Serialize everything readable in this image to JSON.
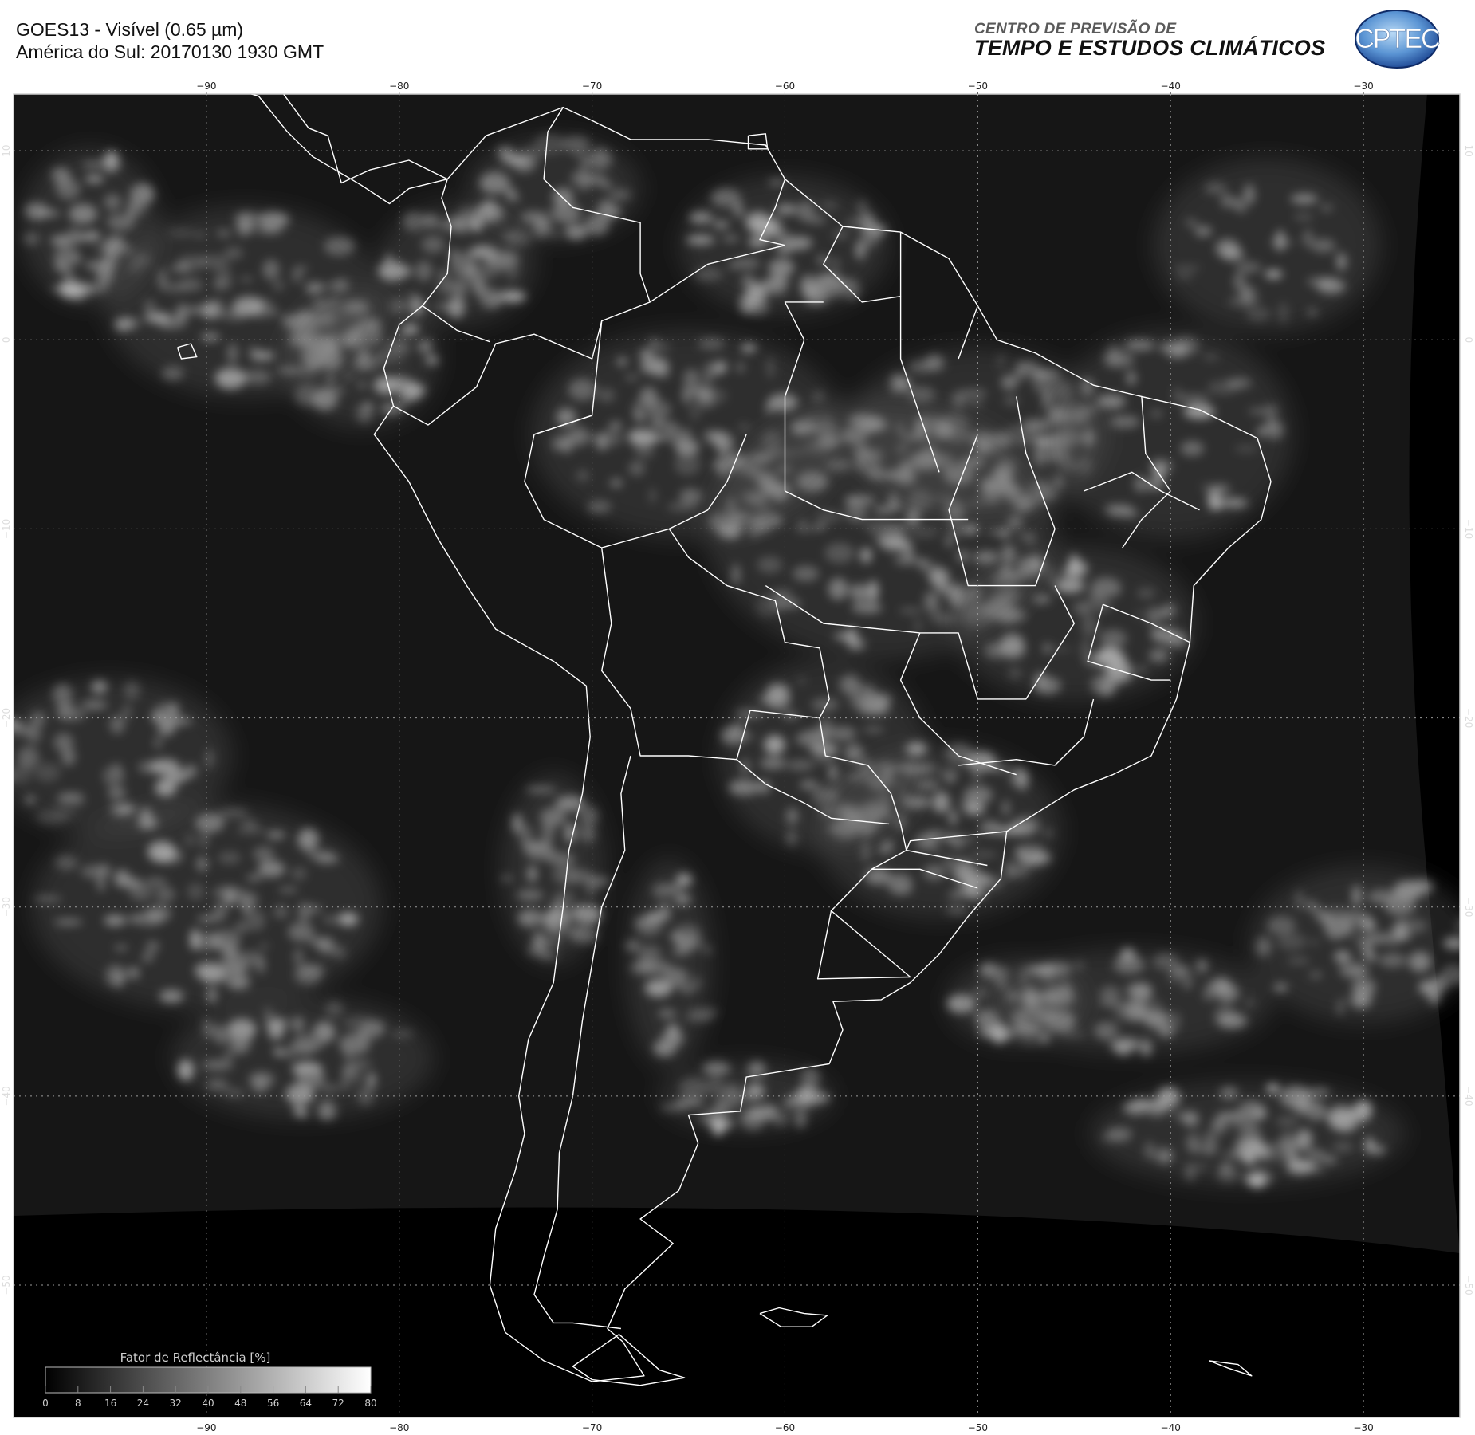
{
  "header": {
    "title_line1": "GOES13 - Visível (0.65 µm)",
    "title_line2": "América do Sul: 20170130 1930 GMT",
    "org_line1": "CENTRO DE PREVISÃO DE",
    "org_line2": "TEMPO E ESTUDOS CLIMÁTICOS",
    "logo_text": "CPTEC",
    "logo_colors": {
      "outer": "#1e4fa0",
      "inner": "#7fb0e0",
      "text": "#ffffff"
    }
  },
  "map": {
    "lon_ticks": [
      -90,
      -80,
      -70,
      -60,
      -50,
      -40,
      -30
    ],
    "lat_ticks": [
      10,
      0,
      -10,
      -20,
      -30,
      -40,
      -50
    ],
    "lon_range": [
      -100,
      -25
    ],
    "lat_range": [
      13,
      -57
    ],
    "background": "#000000",
    "coast_color": "#ffffff",
    "grid_style": "dotted"
  },
  "colorbar": {
    "title": "Fator de Reflectância [%]",
    "ticks": [
      "0",
      "8",
      "16",
      "24",
      "32",
      "40",
      "48",
      "56",
      "64",
      "72",
      "80"
    ],
    "range": [
      0,
      80
    ]
  }
}
